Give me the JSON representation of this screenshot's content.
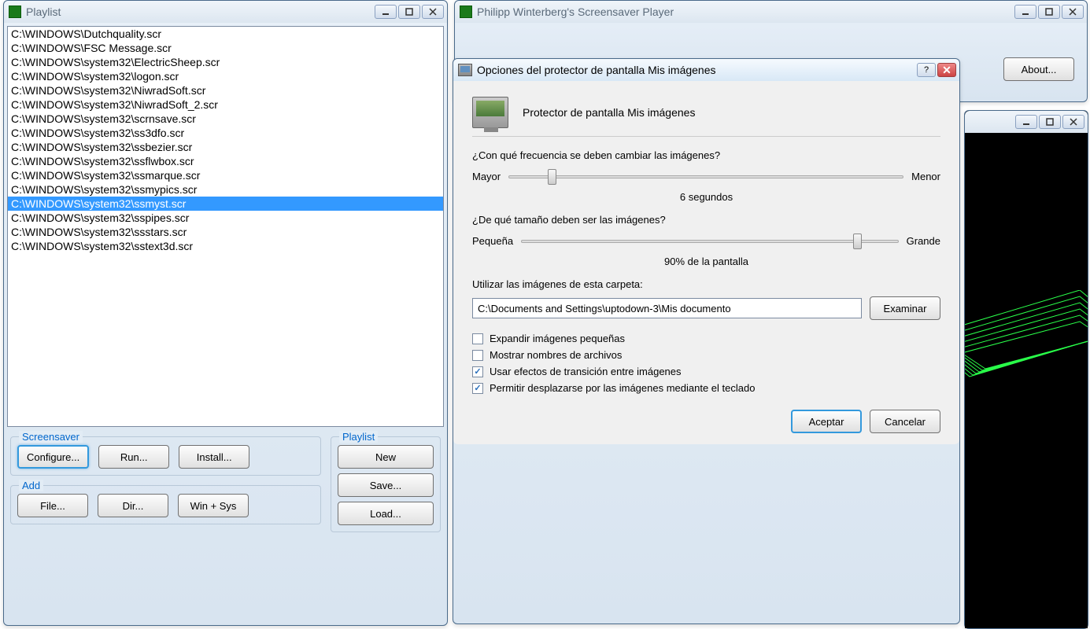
{
  "playlist_window": {
    "title": "Playlist",
    "items": [
      "C:\\WINDOWS\\Dutchquality.scr",
      "C:\\WINDOWS\\FSC Message.scr",
      "C:\\WINDOWS\\system32\\ElectricSheep.scr",
      "C:\\WINDOWS\\system32\\logon.scr",
      "C:\\WINDOWS\\system32\\NiwradSoft.scr",
      "C:\\WINDOWS\\system32\\NiwradSoft_2.scr",
      "C:\\WINDOWS\\system32\\scrnsave.scr",
      "C:\\WINDOWS\\system32\\ss3dfo.scr",
      "C:\\WINDOWS\\system32\\ssbezier.scr",
      "C:\\WINDOWS\\system32\\ssflwbox.scr",
      "C:\\WINDOWS\\system32\\ssmarque.scr",
      "C:\\WINDOWS\\system32\\ssmypics.scr",
      "C:\\WINDOWS\\system32\\ssmyst.scr",
      "C:\\WINDOWS\\system32\\sspipes.scr",
      "C:\\WINDOWS\\system32\\ssstars.scr",
      "C:\\WINDOWS\\system32\\sstext3d.scr"
    ],
    "selected_index": 12,
    "groups": {
      "screensaver": {
        "legend": "Screensaver",
        "buttons": {
          "configure": "Configure...",
          "run": "Run...",
          "install": "Install..."
        }
      },
      "add": {
        "legend": "Add",
        "buttons": {
          "file": "File...",
          "dir": "Dir...",
          "winsys": "Win + Sys"
        }
      },
      "playlist": {
        "legend": "Playlist",
        "buttons": {
          "new": "New",
          "save": "Save...",
          "load": "Load..."
        }
      }
    }
  },
  "main_window": {
    "title": "Philipp Winterberg's Screensaver Player",
    "about": "About..."
  },
  "dialog": {
    "title": "Opciones del protector de pantalla Mis imágenes",
    "header": "Protector de pantalla Mis imágenes",
    "freq_question": "¿Con qué frecuencia se deben cambiar las imágenes?",
    "freq_min": "Mayor",
    "freq_max": "Menor",
    "freq_value": "6 segundos",
    "freq_slider_pct": 10,
    "size_question": "¿De qué tamaño deben ser las imágenes?",
    "size_min": "Pequeña",
    "size_max": "Grande",
    "size_value": "90% de la pantalla",
    "size_slider_pct": 88,
    "folder_label": "Utilizar las imágenes de esta carpeta:",
    "folder_path": "C:\\Documents and Settings\\uptodown-3\\Mis documento",
    "browse": "Examinar",
    "checks": {
      "expand": {
        "label": "Expandir imágenes pequeñas",
        "checked": false
      },
      "names": {
        "label": "Mostrar nombres de archivos",
        "checked": false
      },
      "transitions": {
        "label": "Usar efectos de transición entre imágenes",
        "checked": true
      },
      "keyboard": {
        "label": "Permitir desplazarse por las imágenes mediante el teclado",
        "checked": true
      }
    },
    "ok": "Aceptar",
    "cancel": "Cancelar"
  }
}
